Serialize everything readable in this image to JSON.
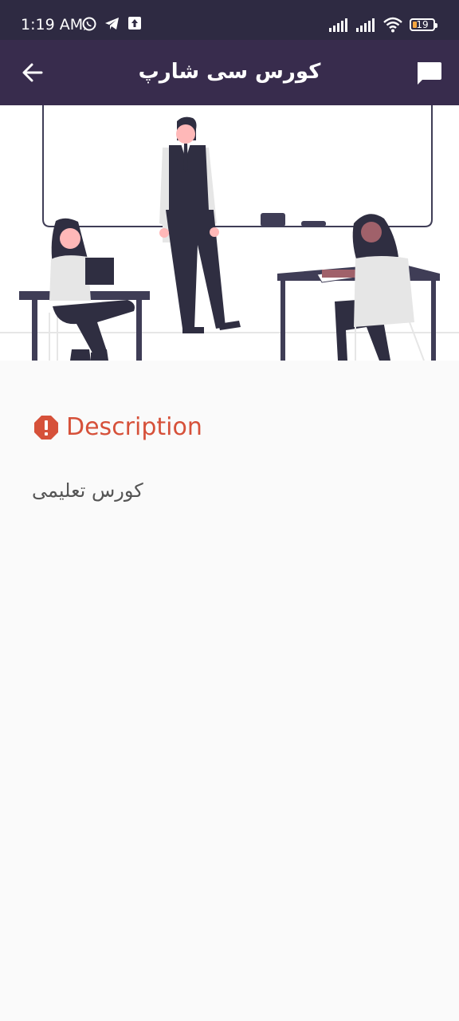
{
  "status_bar": {
    "time": "1:19 AM",
    "left_icons": [
      "whatsapp-icon",
      "telegram-icon",
      "upload-icon"
    ],
    "right_icons": [
      "signal-icon",
      "signal-icon",
      "wifi-icon",
      "battery-icon"
    ],
    "battery_level": "19",
    "battery_color": "#f4a640"
  },
  "app_bar": {
    "title": "کورس سی شارپ",
    "back_icon": "arrow-left-icon",
    "chat_icon": "chat-icon",
    "background": "#382c4d"
  },
  "hero": {
    "illustration": "classroom-illustration"
  },
  "description": {
    "heading": "Description",
    "heading_color": "#d6513a",
    "icon": "alert-octagon-icon",
    "text": "کورس تعلیمی"
  }
}
